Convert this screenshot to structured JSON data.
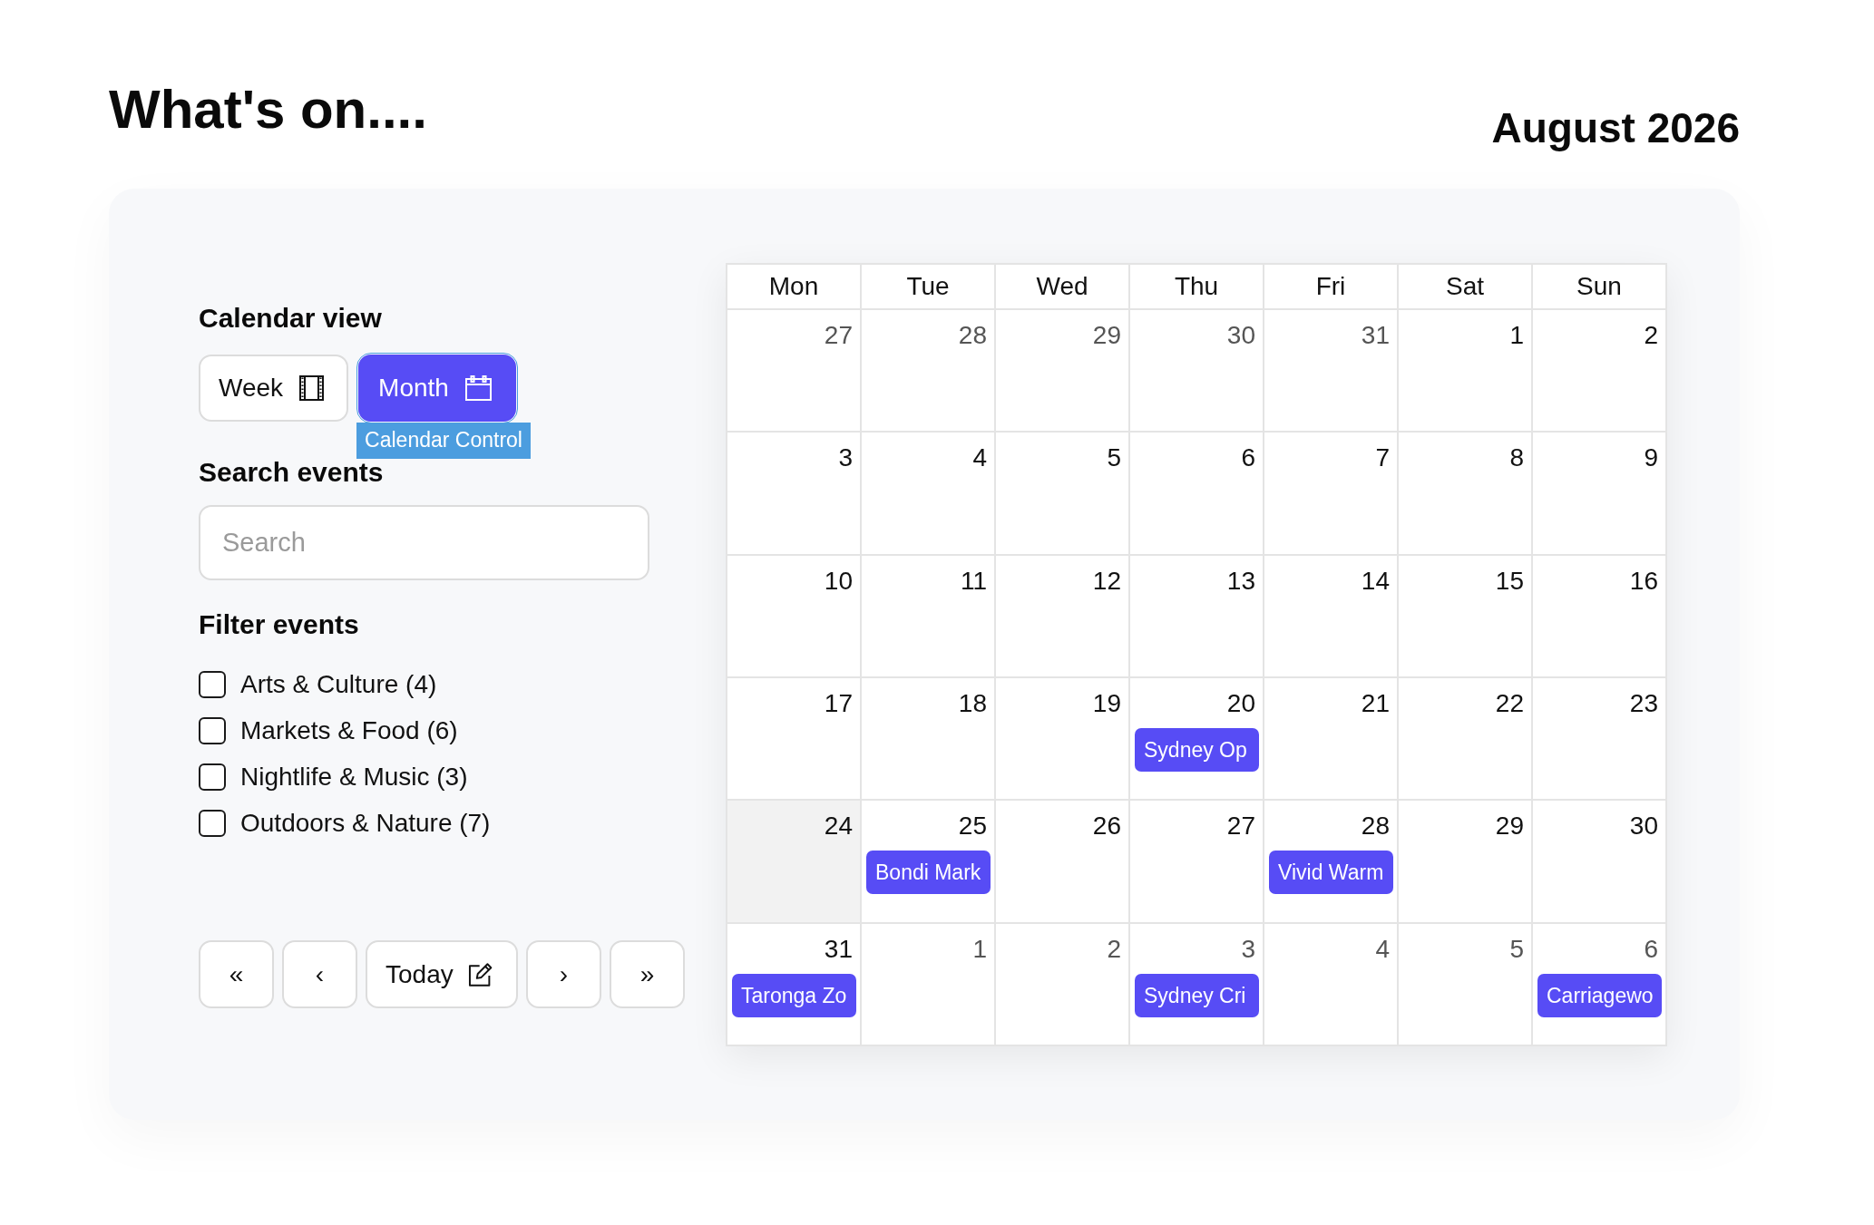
{
  "header": {
    "title": "What's on....",
    "month_label": "August 2026"
  },
  "sidebar": {
    "view_heading": "Calendar view",
    "view_buttons": [
      {
        "label": "Week",
        "kind": "week",
        "selected": false,
        "focused": false
      },
      {
        "label": "Month",
        "kind": "month",
        "selected": true,
        "focused": true,
        "tooltip": "Calendar Control"
      }
    ],
    "search_heading": "Search events",
    "search": {
      "placeholder": "Search"
    },
    "filter_heading": "Filter events",
    "filters": [
      {
        "label": "Arts & Culture (4)",
        "checked": false
      },
      {
        "label": "Markets & Food (6)",
        "checked": false
      },
      {
        "label": "Nightlife & Music (3)",
        "checked": false
      },
      {
        "label": "Outdoors & Nature (7)",
        "checked": false
      }
    ],
    "nav_buttons": [
      {
        "label": "«",
        "kind": "arrow"
      },
      {
        "label": "‹",
        "kind": "arrow"
      },
      {
        "label": "Today",
        "kind": "today"
      },
      {
        "label": "›",
        "kind": "arrow"
      },
      {
        "label": "»",
        "kind": "arrow"
      }
    ]
  },
  "calendar": {
    "weekdays": [
      "Mon",
      "Tue",
      "Wed",
      "Thu",
      "Fri",
      "Sat",
      "Sun"
    ],
    "weeks": [
      {
        "days": [
          {
            "day": "27",
            "in_month": false,
            "highlighted": false
          },
          {
            "day": "28",
            "in_month": false,
            "highlighted": false
          },
          {
            "day": "29",
            "in_month": false,
            "highlighted": false
          },
          {
            "day": "30",
            "in_month": false,
            "highlighted": false
          },
          {
            "day": "31",
            "in_month": false,
            "highlighted": false
          },
          {
            "day": "1",
            "in_month": true,
            "highlighted": false
          },
          {
            "day": "2",
            "in_month": true,
            "highlighted": false
          }
        ]
      },
      {
        "days": [
          {
            "day": "3",
            "in_month": true,
            "highlighted": false
          },
          {
            "day": "4",
            "in_month": true,
            "highlighted": false
          },
          {
            "day": "5",
            "in_month": true,
            "highlighted": false
          },
          {
            "day": "6",
            "in_month": true,
            "highlighted": false
          },
          {
            "day": "7",
            "in_month": true,
            "highlighted": false
          },
          {
            "day": "8",
            "in_month": true,
            "highlighted": false
          },
          {
            "day": "9",
            "in_month": true,
            "highlighted": false
          }
        ]
      },
      {
        "days": [
          {
            "day": "10",
            "in_month": true,
            "highlighted": false
          },
          {
            "day": "11",
            "in_month": true,
            "highlighted": false
          },
          {
            "day": "12",
            "in_month": true,
            "highlighted": false
          },
          {
            "day": "13",
            "in_month": true,
            "highlighted": false
          },
          {
            "day": "14",
            "in_month": true,
            "highlighted": false
          },
          {
            "day": "15",
            "in_month": true,
            "highlighted": false
          },
          {
            "day": "16",
            "in_month": true,
            "highlighted": false
          }
        ]
      },
      {
        "days": [
          {
            "day": "17",
            "in_month": true,
            "highlighted": false
          },
          {
            "day": "18",
            "in_month": true,
            "highlighted": false
          },
          {
            "day": "19",
            "in_month": true,
            "highlighted": false
          },
          {
            "day": "20",
            "in_month": true,
            "highlighted": false,
            "events": [
              {
                "title": "Sydney Op"
              }
            ]
          },
          {
            "day": "21",
            "in_month": true,
            "highlighted": false
          },
          {
            "day": "22",
            "in_month": true,
            "highlighted": false
          },
          {
            "day": "23",
            "in_month": true,
            "highlighted": false
          }
        ]
      },
      {
        "days": [
          {
            "day": "24",
            "in_month": true,
            "highlighted": true
          },
          {
            "day": "25",
            "in_month": true,
            "highlighted": false,
            "events": [
              {
                "title": "Bondi Mark"
              }
            ]
          },
          {
            "day": "26",
            "in_month": true,
            "highlighted": false
          },
          {
            "day": "27",
            "in_month": true,
            "highlighted": false
          },
          {
            "day": "28",
            "in_month": true,
            "highlighted": false,
            "events": [
              {
                "title": "Vivid Warm"
              }
            ]
          },
          {
            "day": "29",
            "in_month": true,
            "highlighted": false
          },
          {
            "day": "30",
            "in_month": true,
            "highlighted": false
          }
        ]
      },
      {
        "days": [
          {
            "day": "31",
            "in_month": true,
            "highlighted": false,
            "events": [
              {
                "title": "Taronga Zo"
              }
            ]
          },
          {
            "day": "1",
            "in_month": false,
            "highlighted": false
          },
          {
            "day": "2",
            "in_month": false,
            "highlighted": false
          },
          {
            "day": "3",
            "in_month": false,
            "highlighted": false,
            "events": [
              {
                "title": "Sydney Cri"
              }
            ]
          },
          {
            "day": "4",
            "in_month": false,
            "highlighted": false
          },
          {
            "day": "5",
            "in_month": false,
            "highlighted": false
          },
          {
            "day": "6",
            "in_month": false,
            "highlighted": false,
            "events": [
              {
                "title": "Carriagewo"
              }
            ]
          }
        ]
      }
    ]
  }
}
